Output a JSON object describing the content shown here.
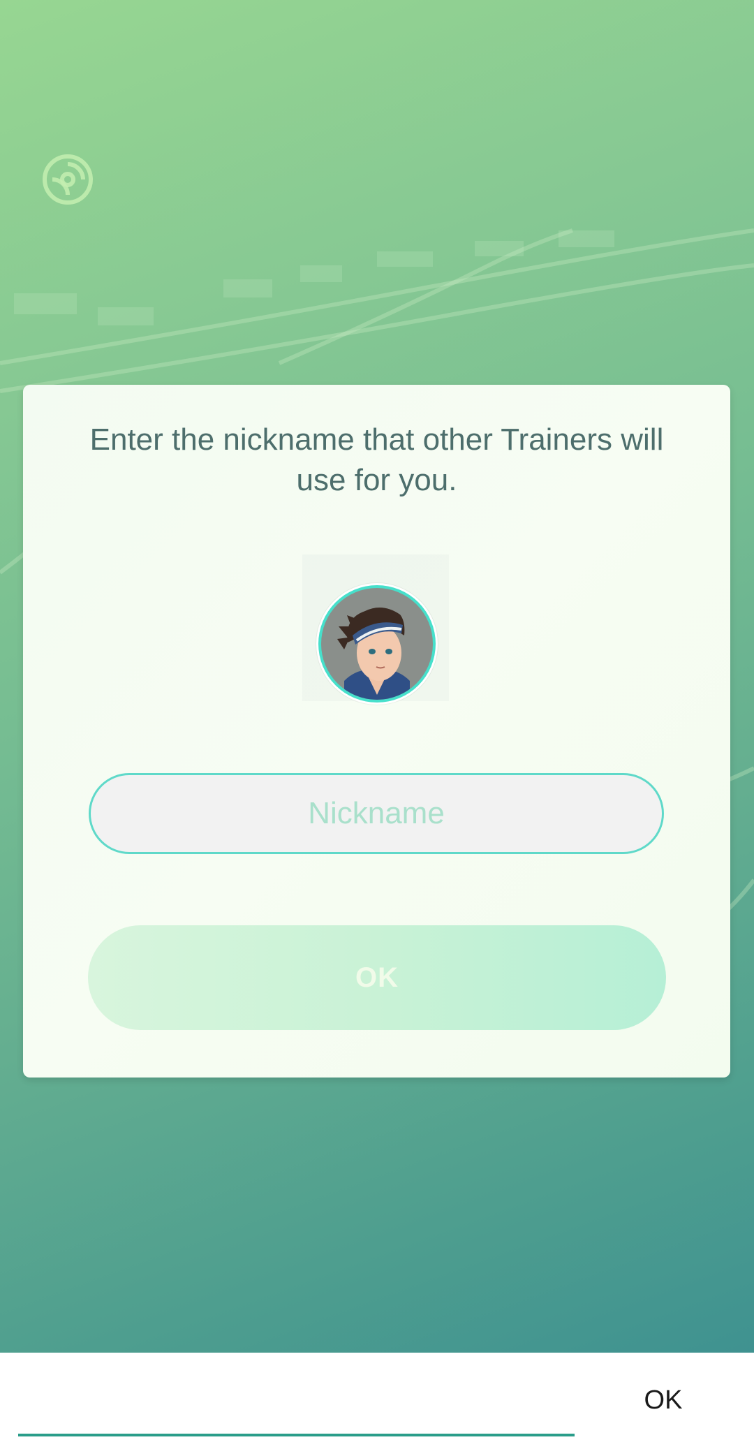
{
  "dialog": {
    "message": "Enter the nickname that other Trainers will use for you.",
    "nickname_placeholder": "Nickname",
    "ok_label": "OK"
  },
  "keyboard_bar": {
    "input_value": "",
    "ok_label": "OK"
  },
  "colors": {
    "accent": "#5fd9c9",
    "message_text": "#4d6e6c",
    "keyboard_underline": "#2a9d8a"
  },
  "icons": {
    "logo": "pokeball-icon",
    "avatar": "trainer-avatar"
  }
}
